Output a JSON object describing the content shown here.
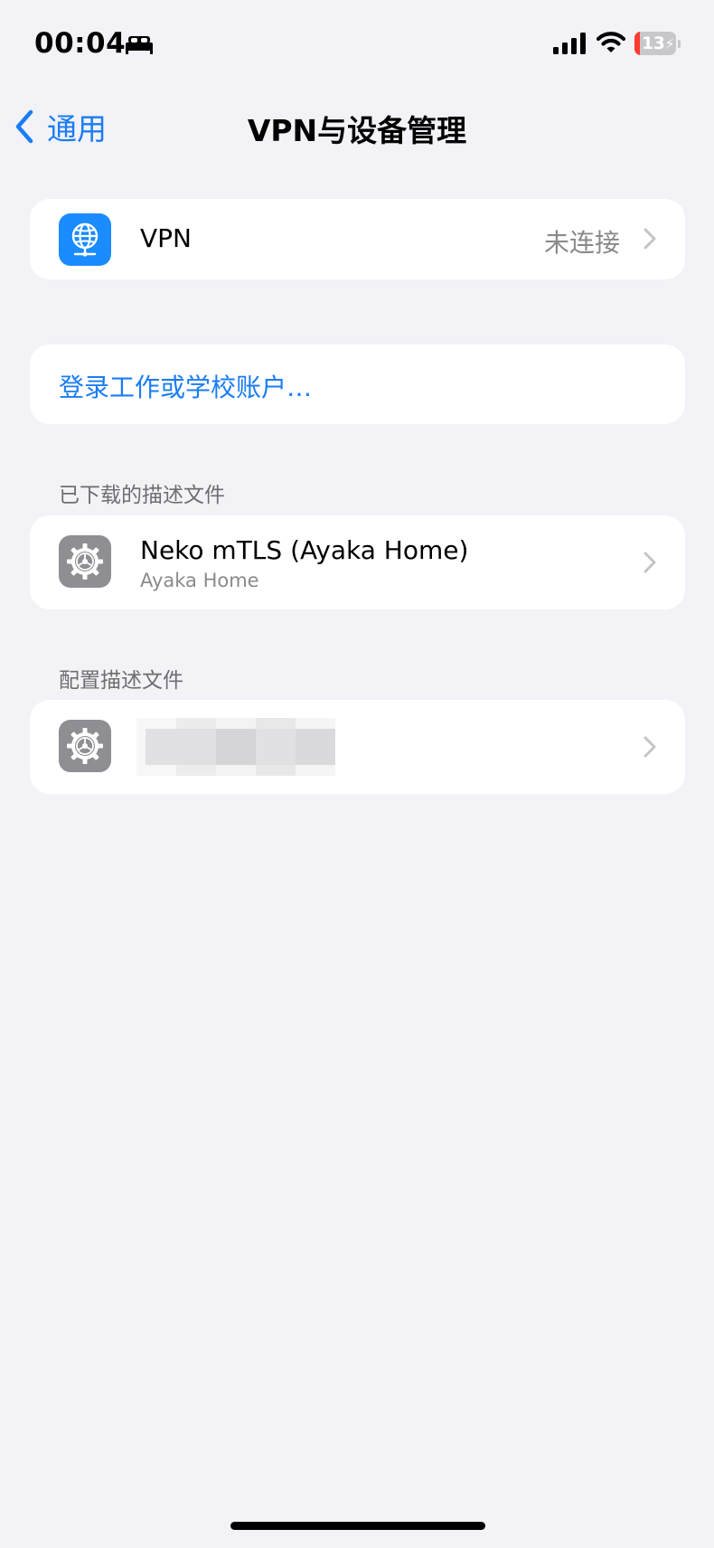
{
  "status_bar": {
    "time": "00:04",
    "battery_level": "13",
    "battery_fraction": 0.13,
    "icons": [
      "sleep-focus-icon",
      "cellular-signal-icon",
      "wifi-icon",
      "battery-charging-icon"
    ]
  },
  "nav": {
    "back_label": "通用",
    "title": "VPN与设备管理"
  },
  "vpn_row": {
    "label": "VPN",
    "value": "未连接",
    "icon": "globe-network-icon"
  },
  "signin_row": {
    "label": "登录工作或学校账户…"
  },
  "downloaded_section": {
    "header": "已下载的描述文件",
    "items": [
      {
        "title": "Neko mTLS (Ayaka Home)",
        "subtitle": "Ayaka Home",
        "icon": "gear-settings-icon"
      }
    ]
  },
  "config_section": {
    "header": "配置描述文件",
    "items": [
      {
        "title": "",
        "redacted": true,
        "icon": "gear-settings-icon"
      }
    ]
  },
  "colors": {
    "background": "#f2f2f7",
    "accent": "#1a7cf4",
    "vpn_icon_bg": "#1a8cff",
    "settings_icon_bg": "#8e8e93",
    "battery_low": "#ff3b30"
  }
}
